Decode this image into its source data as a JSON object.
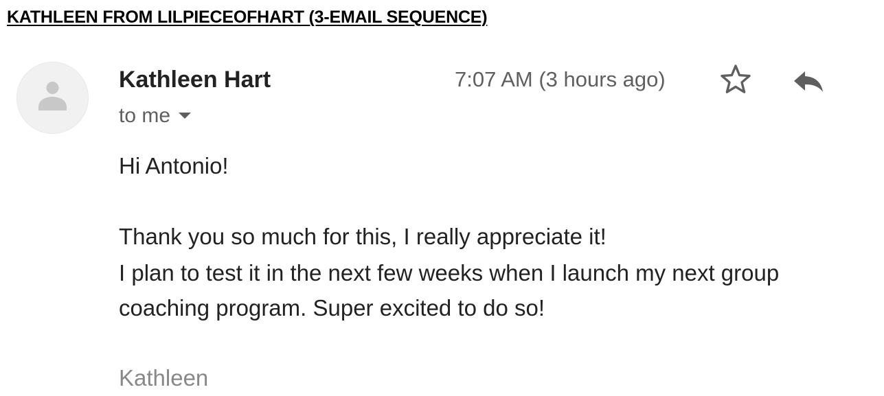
{
  "document": {
    "title": "KATHLEEN FROM LILPIECEOFHART (3-EMAIL SEQUENCE)"
  },
  "email": {
    "avatar_icon": "person-placeholder-icon",
    "sender_name": "Kathleen Hart",
    "timestamp": "7:07 AM (3 hours ago)",
    "recipient_label": "to me",
    "actions": {
      "star_icon": "star-outline-icon",
      "reply_icon": "reply-arrow-icon"
    },
    "body": {
      "greeting": "Hi Antonio!",
      "lines": [
        "Thank you so much for this, I really appreciate it!",
        "I plan to test it in the next few weeks when I launch my next group",
        "coaching program. Super excited to do so!"
      ],
      "signature": "Kathleen"
    }
  },
  "colors": {
    "text_primary": "#222222",
    "text_secondary": "#5f5f5f",
    "signature_gray": "#888888",
    "avatar_bg": "#f1f1f1",
    "avatar_glyph": "#c8c8c8",
    "icon_gray": "#5f5f5f"
  }
}
